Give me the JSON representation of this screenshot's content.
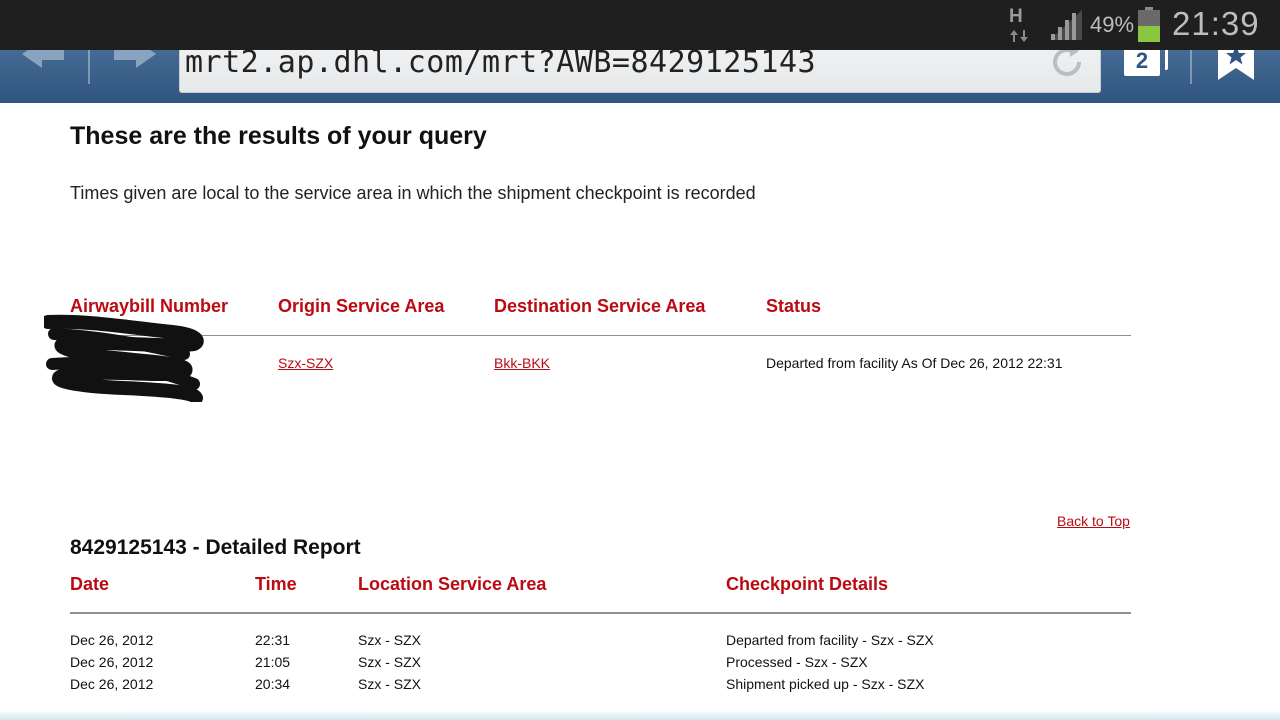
{
  "status_bar": {
    "network_type": "H",
    "battery_percent": "49%",
    "battery_level": 0.49,
    "clock": "21:39",
    "signal_icon": "signal-strength-icon"
  },
  "browser": {
    "url": "mrt2.ap.dhl.com/mrt?AWB=8429125143",
    "tab_count": "2",
    "icons": [
      "back-arrow-icon",
      "forward-arrow-icon",
      "reload-icon",
      "tabs-icon",
      "bookmark-icon"
    ]
  },
  "page": {
    "title": "These are the results of your query",
    "note": "Times given are local to the service area in which the shipment checkpoint is recorded",
    "summary": {
      "headers": [
        "Airwaybill Number",
        "Origin Service Area",
        "Destination Service Area",
        "Status"
      ],
      "row": {
        "origin": "Szx-SZX",
        "destination": "Bkk-BKK",
        "status": "Departed from facility As Of Dec 26, 2012 22:31"
      }
    },
    "back_to_top": "Back to Top",
    "report": {
      "title": "8429125143 - Detailed Report",
      "headers": [
        "Date",
        "Time",
        "Location Service Area",
        "Checkpoint Details"
      ],
      "rows": [
        {
          "date": "Dec 26, 2012",
          "time": "22:31",
          "location": "Szx - SZX",
          "details": "Departed from facility - Szx - SZX"
        },
        {
          "date": "Dec 26, 2012",
          "time": "21:05",
          "location": "Szx - SZX",
          "details": "Processed - Szx - SZX"
        },
        {
          "date": "Dec 26, 2012",
          "time": "20:34",
          "location": "Szx - SZX",
          "details": "Shipment picked up - Szx - SZX"
        }
      ]
    },
    "colors": {
      "accent_red": "#bb0a12",
      "toolbar_blue": "#2f5580",
      "status_bar": "#1f1f1f"
    }
  }
}
